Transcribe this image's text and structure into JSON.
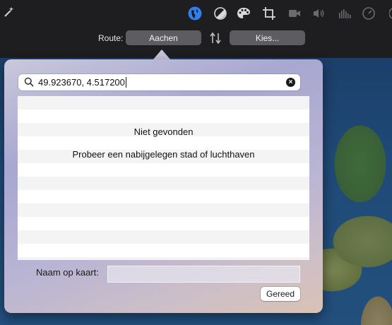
{
  "toolbar": {
    "icons": [
      {
        "name": "magic-wand-icon",
        "glyph": "✨"
      },
      {
        "name": "globe-icon",
        "glyph": "●"
      },
      {
        "name": "color-balance-icon",
        "glyph": "◐"
      },
      {
        "name": "palette-icon",
        "glyph": "🎨"
      },
      {
        "name": "crop-icon",
        "glyph": "⌖"
      },
      {
        "name": "camera-icon",
        "glyph": "■"
      },
      {
        "name": "volume-icon",
        "glyph": "🔊"
      },
      {
        "name": "equalizer-icon",
        "glyph": "┃"
      },
      {
        "name": "speedometer-icon",
        "glyph": "◔"
      },
      {
        "name": "info-icon",
        "glyph": "ⓘ"
      }
    ]
  },
  "route": {
    "label": "Route:",
    "from": "Aachen",
    "to": "Kies...",
    "swap_icon": "swap-arrows-icon"
  },
  "search": {
    "value": "49.923670, 4.517200",
    "clear_icon": "clear-circle-icon"
  },
  "results": {
    "title": "Niet gevonden",
    "hint": "Probeer een nabijgelegen stad of luchthaven"
  },
  "map_name": {
    "label": "Naam op kaart:",
    "value": ""
  },
  "done_label": "Gereed",
  "colors": {
    "accent": "#2f7ff0",
    "toolbar_bg": "#1e1e21",
    "pill_bg": "#5d5d61"
  }
}
